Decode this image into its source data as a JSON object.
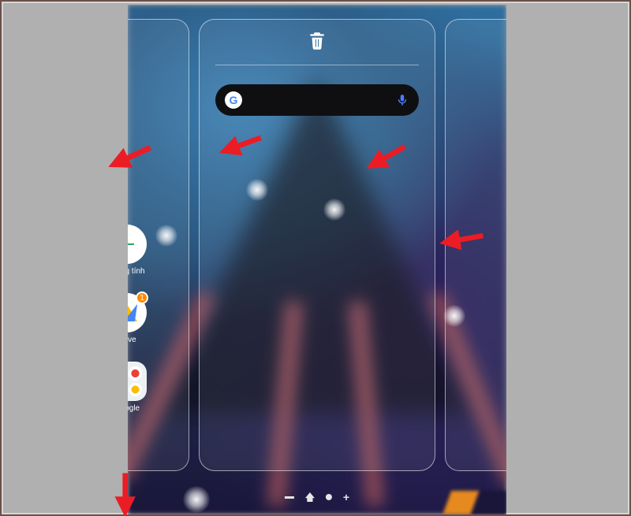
{
  "apps": {
    "sheets": {
      "label": "Trang tính"
    },
    "drive": {
      "label": "Drive",
      "badge": "1"
    },
    "google_folder": {
      "label": "Google"
    }
  },
  "search": {
    "placeholder": ""
  },
  "icons": {
    "trash": "trash",
    "mic": "mic",
    "google_g": "G"
  },
  "page_indicator": {
    "items": [
      "minus",
      "home",
      "dot",
      "plus"
    ]
  }
}
